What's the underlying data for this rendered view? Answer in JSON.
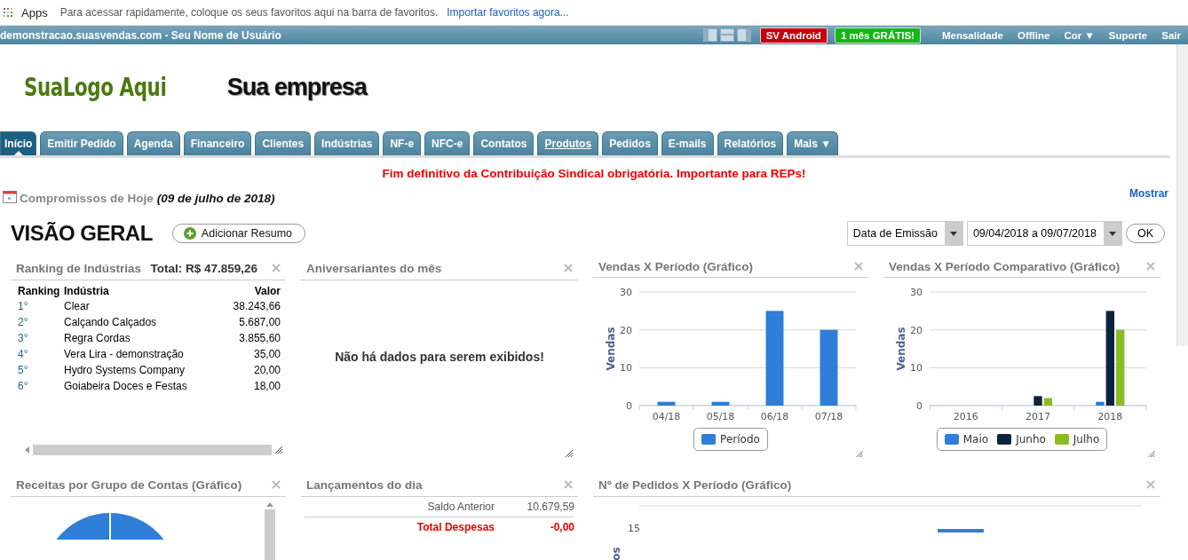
{
  "bookmarks_bar": {
    "apps_label": "Apps",
    "hint": "Para acessar rapidamente, coloque os seus favoritos aqui na barra de favoritos.",
    "import_link": "Importar favoritos agora..."
  },
  "top_bar": {
    "account": "demonstracao.suasvendas.com - Seu Nome de Usuário",
    "badges": [
      {
        "label": "SV Android",
        "color": "#c8000a"
      },
      {
        "label": "1 mês GRÁTIS!",
        "color": "#14b814"
      }
    ],
    "links": [
      "Mensalidade",
      "Offline",
      "Cor ▼",
      "Suporte",
      "Sair"
    ]
  },
  "header": {
    "logo": "SuaLogo Aqui",
    "company": "Sua empresa"
  },
  "tabs": [
    {
      "label": "Início",
      "selected": true,
      "hovered": false
    },
    {
      "label": "Emitir Pedido",
      "selected": false,
      "hovered": false
    },
    {
      "label": "Agenda",
      "selected": false,
      "hovered": false
    },
    {
      "label": "Financeiro",
      "selected": false,
      "hovered": false
    },
    {
      "label": "Clientes",
      "selected": false,
      "hovered": false
    },
    {
      "label": "Indústrias",
      "selected": false,
      "hovered": false
    },
    {
      "label": "NF-e",
      "selected": false,
      "hovered": false
    },
    {
      "label": "NFC-e",
      "selected": false,
      "hovered": false
    },
    {
      "label": "Contatos",
      "selected": false,
      "hovered": false
    },
    {
      "label": "Produtos",
      "selected": false,
      "hovered": true
    },
    {
      "label": "Pedidos",
      "selected": false,
      "hovered": false
    },
    {
      "label": "E-mails",
      "selected": false,
      "hovered": false
    },
    {
      "label": "Relatórios",
      "selected": false,
      "hovered": false
    },
    {
      "label": "Mais ▼",
      "selected": false,
      "hovered": false
    }
  ],
  "notice": "Fim definitivo da Contribuição Sindical obrigatória. Importante para REPs!",
  "appointments": {
    "title": "Compromissos de Hoje",
    "date": "(09 de julho de 2018)",
    "show_link": "Mostrar"
  },
  "overview": {
    "title": "VISÃO GERAL",
    "add_button": "Adicionar Resumo",
    "date_type": "Data de Emissão",
    "date_range": "09/04/2018 a 09/07/2018",
    "ok_button": "OK"
  },
  "ranking_widget": {
    "title": "Ranking de Indústrias",
    "total": "Total: R$ 47.859,26",
    "columns": [
      "Ranking",
      "Indústria",
      "Valor"
    ],
    "rows": [
      [
        "1°",
        "Clear",
        "38.243,66"
      ],
      [
        "2°",
        "Calçando Calçados",
        "5.687,00"
      ],
      [
        "3°",
        "Regra Cordas",
        "3.855,60"
      ],
      [
        "4°",
        "Vera Lira - demonstração",
        "35,00"
      ],
      [
        "5°",
        "Hydro Systems Company",
        "20,00"
      ],
      [
        "6°",
        "Goiabeira Doces e Festas",
        "18,00"
      ]
    ]
  },
  "birthdays_widget": {
    "title": "Aniversariantes do mês",
    "empty_message": "Não há dados para serem exibidos!"
  },
  "sales_widget": {
    "title": "Vendas X Período (Gráfico)",
    "chart_data": {
      "type": "bar",
      "ylabel": "Vendas",
      "categories": [
        "04/18",
        "05/18",
        "06/18",
        "07/18"
      ],
      "series": [
        {
          "name": "Período",
          "color": "#2f7ed8",
          "values": [
            1,
            1,
            25,
            20
          ]
        }
      ],
      "ylim": [
        0,
        30
      ],
      "yticks": [
        0,
        10,
        20,
        30
      ],
      "legend": "bottom"
    }
  },
  "compare_widget": {
    "title": "Vendas X Período Comparativo (Gráfico)",
    "chart_data": {
      "type": "bar",
      "ylabel": "Vendas",
      "categories": [
        "2016",
        "2017",
        "2018"
      ],
      "series": [
        {
          "name": "Maio",
          "color": "#2f7ed8",
          "values": [
            0,
            0,
            1
          ]
        },
        {
          "name": "Junho",
          "color": "#0d233a",
          "values": [
            0,
            2.5,
            25
          ]
        },
        {
          "name": "Julho",
          "color": "#8bbc21",
          "values": [
            0,
            2,
            20
          ]
        }
      ],
      "ylim": [
        0,
        30
      ],
      "yticks": [
        0,
        10,
        20,
        30
      ],
      "legend": "bottom"
    }
  },
  "revenue_widget": {
    "title": "Receitas por Grupo de Contas (Gráfico)"
  },
  "entries_widget": {
    "title": "Lançamentos do dia",
    "rows": [
      {
        "label": "Saldo Anterior",
        "value": "10.679,59",
        "kind": "normal"
      },
      {
        "label": "Total Despesas",
        "value": "-0,00",
        "kind": "negative"
      }
    ]
  },
  "orders_widget": {
    "title": "Nº de Pedidos X Período (Gráfico)",
    "top_tick": "15",
    "ylabel_fragment": "os"
  }
}
